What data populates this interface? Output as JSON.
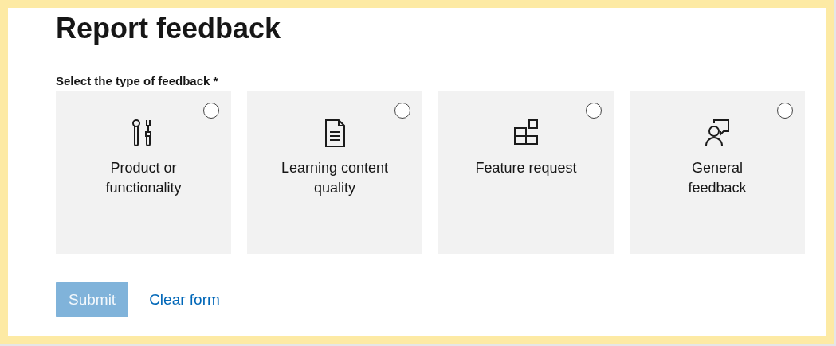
{
  "title": "Report feedback",
  "feedback_type": {
    "label": "Select the type of feedback",
    "required_mark": "*",
    "options": [
      {
        "label": "Product or functionality",
        "kind": "tools",
        "selected": false
      },
      {
        "label": "Learning content quality",
        "kind": "document",
        "selected": false
      },
      {
        "label": "Feature request",
        "kind": "blocks",
        "selected": false
      },
      {
        "label": "General feedback",
        "kind": "person",
        "selected": false
      }
    ]
  },
  "buttons": {
    "submit": {
      "label": "Submit",
      "disabled": true
    },
    "clear": {
      "label": "Clear form"
    }
  }
}
